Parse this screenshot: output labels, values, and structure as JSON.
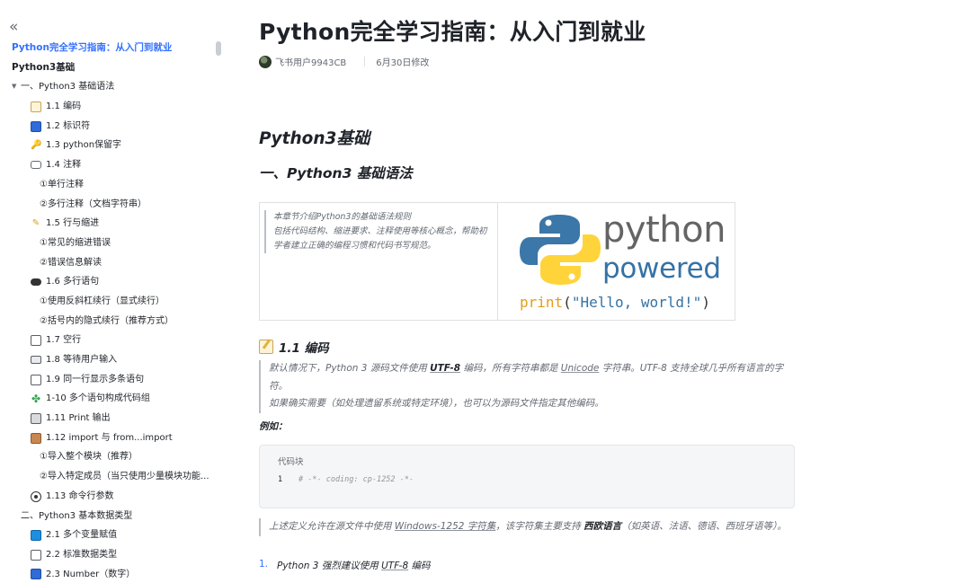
{
  "sidebar": {
    "collapse_icon": "double-chevron-left-icon",
    "items": [
      {
        "label": "Python完全学习指南：从入门到就业",
        "level": 0,
        "active": true,
        "icon": ""
      },
      {
        "label": "Python3基础",
        "level": 0,
        "active": false,
        "icon": ""
      },
      {
        "label": "一、Python3 基础语法",
        "level": 1,
        "expanded": true,
        "icon": ""
      },
      {
        "label": "1.1 编码",
        "level": 2,
        "icon": "memo-icon"
      },
      {
        "label": "1.2 标识符",
        "level": 2,
        "icon": "id-icon"
      },
      {
        "label": "1.3 python保留字",
        "level": 2,
        "icon": "key-icon"
      },
      {
        "label": "1.4 注释",
        "level": 2,
        "icon": "speech-bubble-icon"
      },
      {
        "label": "①单行注释",
        "level": 3,
        "icon": ""
      },
      {
        "label": "②多行注释（文档字符串）",
        "level": 3,
        "icon": ""
      },
      {
        "label": "1.5 行与缩进",
        "level": 2,
        "icon": "pencil-icon"
      },
      {
        "label": "①常见的缩进错误",
        "level": 3,
        "icon": ""
      },
      {
        "label": "②错误信息解读",
        "level": 3,
        "icon": ""
      },
      {
        "label": "1.6 多行语句",
        "level": 2,
        "icon": "pill-icon"
      },
      {
        "label": "①使用反斜杠续行（显式续行）",
        "level": 3,
        "icon": ""
      },
      {
        "label": "②括号内的隐式续行（推荐方式）",
        "level": 3,
        "icon": ""
      },
      {
        "label": "1.7 空行",
        "level": 2,
        "icon": "page-icon"
      },
      {
        "label": "1.8 等待用户输入",
        "level": 2,
        "icon": "keyboard-icon"
      },
      {
        "label": "1.9 同一行显示多条语句",
        "level": 2,
        "icon": "page-icon"
      },
      {
        "label": "1-10 多个语句构成代码组",
        "level": 2,
        "icon": "clover-icon"
      },
      {
        "label": "1.11 Print 输出",
        "level": 2,
        "icon": "printer-icon"
      },
      {
        "label": "1.12 import 与 from...import",
        "level": 2,
        "icon": "package-icon"
      },
      {
        "label": "①导入整个模块（推荐）",
        "level": 3,
        "icon": ""
      },
      {
        "label": "②导入特定成员（当只使用少量模块功能...",
        "level": 3,
        "icon": ""
      },
      {
        "label": "1.13 命令行参数",
        "level": 2,
        "icon": "record-button-icon"
      },
      {
        "label": "二、Python3 基本数据类型",
        "level": 1,
        "expanded": false,
        "icon": ""
      },
      {
        "label": "2.1 多个变量赋值",
        "level": 2,
        "icon": "repeat-icon"
      },
      {
        "label": "2.2 标准数据类型",
        "level": 2,
        "icon": "bar-chart-icon"
      },
      {
        "label": "2.3 Number（数字）",
        "level": 2,
        "icon": "numbers-icon"
      }
    ]
  },
  "doc": {
    "title": "Python完全学习指南：从入门到就业",
    "author": "飞书用户9943CB",
    "modified": "6月30日修改",
    "h1": "Python3基础",
    "h2": "一、Python3 基础语法",
    "grid": {
      "quote_line1": "本章节介绍Python3的基础语法规则",
      "quote_line2": "包括代码结构、缩进要求、注释使用等核心概念，帮助初学者建立正确的编程习惯和代码书写规范。",
      "logo_word": "python",
      "logo_powered": "powered",
      "logo_print_fn": "print",
      "logo_print_open": "(",
      "logo_print_str": "\"Hello, world!\"",
      "logo_print_close": ")"
    },
    "section_title": "1.1 编码",
    "para1": {
      "t1": "默认情况下，Python 3 源码文件使用 ",
      "b1": "UTF-8",
      "t2": " 编码，所有字符串都是 ",
      "u1": "Unicode",
      "t3": " 字符串。UTF-8 支持全球几乎所有语言的字符。",
      "line2": "如果确实需要（如处理遗留系统或特定环境），也可以为源码文件指定其他编码。"
    },
    "example_label": "例如：",
    "code": {
      "title": "代码块",
      "line_no": "1",
      "line_text": "# -*- coding: cp-1252 -*-"
    },
    "para2": {
      "t1": "上述定义允许在源文件中使用 ",
      "u1": "Windows-1252 字符集",
      "t2": "，该字符集主要支持 ",
      "b1": "西欧语言",
      "t3": "（如英语、法语、德语、西班牙语等）。"
    },
    "list_item": {
      "num": "1.",
      "t1": "Python 3 强烈建议使用 ",
      "u1": "UTF-8",
      "t2": " 编码"
    }
  }
}
